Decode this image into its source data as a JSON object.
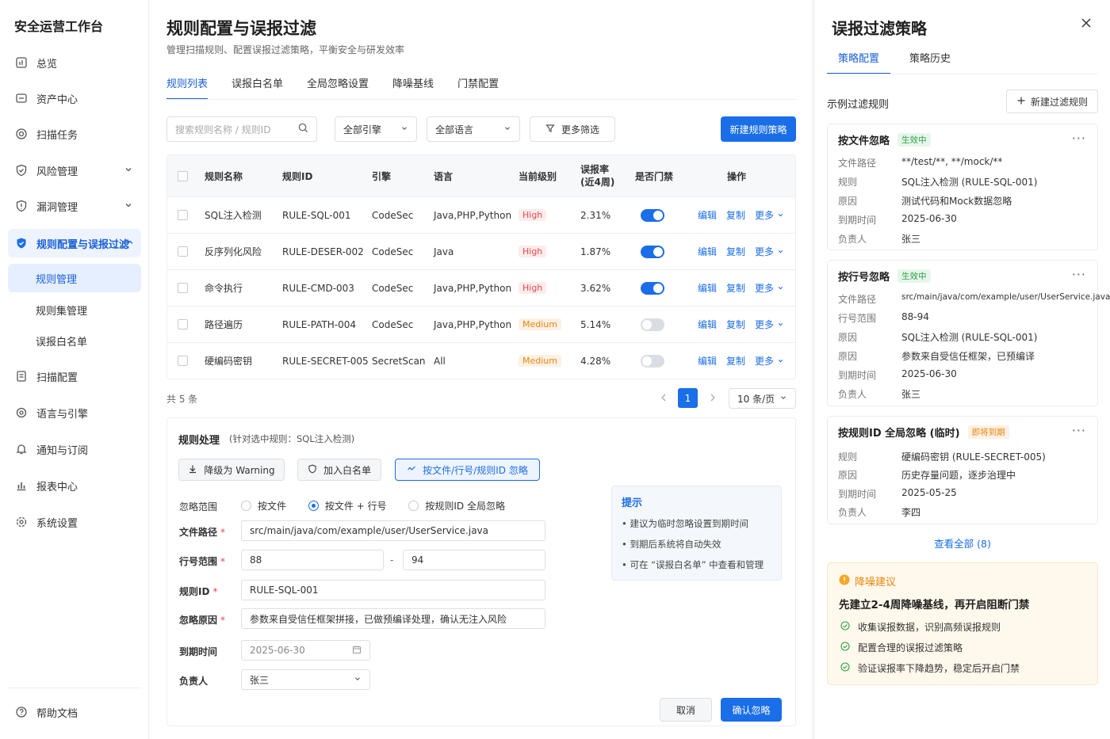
{
  "sidebar": {
    "app_title": "安全运营工作台",
    "items": [
      {
        "label": "总览",
        "icon": "dashboard-icon"
      },
      {
        "label": "资产中心",
        "icon": "asset-icon"
      },
      {
        "label": "扫描任务",
        "icon": "scan-icon"
      },
      {
        "label": "风险管理",
        "icon": "shield-icon"
      },
      {
        "label": "漏洞管理",
        "icon": "bug-icon"
      },
      {
        "label": "规则配置与误报过滤",
        "icon": "shield-filled-icon"
      },
      {
        "label": "扫描配置",
        "icon": "doc-icon"
      },
      {
        "label": "语言与引擎",
        "icon": "gear-icon"
      },
      {
        "label": "通知与订阅",
        "icon": "bell-icon"
      },
      {
        "label": "报表中心",
        "icon": "chart-icon"
      },
      {
        "label": "系统设置",
        "icon": "settings-icon"
      }
    ],
    "sub_items": [
      "规则管理",
      "规则集管理",
      "误报白名单"
    ],
    "help": "帮助文档"
  },
  "main": {
    "title": "规则配置与误报过滤",
    "subtitle": "管理扫描规则、配置误报过滤策略，平衡安全与研发效率",
    "tabs": [
      "规则列表",
      "误报白名单",
      "全局忽略设置",
      "降噪基线",
      "门禁配置"
    ],
    "search_placeholder": "搜索规则名称 / 规则ID",
    "engine_filter": "全部引擎",
    "lang_filter": "全部语言",
    "more_filter": "更多筛选",
    "new_button": "新建规则策略",
    "table": {
      "headers": [
        "规则名称",
        "规则ID",
        "引擎",
        "语言",
        "当前级别",
        "误报率",
        "(近4周)",
        "是否门禁",
        "操作"
      ],
      "rows": [
        {
          "name": "SQL注入检测",
          "id": "RULE-SQL-001",
          "engine": "CodeSec",
          "lang": "Java,PHP,Python",
          "level": "High",
          "rate": "2.31%",
          "gate": true
        },
        {
          "name": "反序列化风险",
          "id": "RULE-DESER-002",
          "engine": "CodeSec",
          "lang": "Java",
          "level": "High",
          "rate": "1.87%",
          "gate": true
        },
        {
          "name": "命令执行",
          "id": "RULE-CMD-003",
          "engine": "CodeSec",
          "lang": "Java,PHP,Python",
          "level": "High",
          "rate": "3.62%",
          "gate": true
        },
        {
          "name": "路径遍历",
          "id": "RULE-PATH-004",
          "engine": "CodeSec",
          "lang": "Java,PHP,Python",
          "level": "Medium",
          "rate": "5.14%",
          "gate": false
        },
        {
          "name": "硬编码密钥",
          "id": "RULE-SECRET-005",
          "engine": "SecretScan",
          "lang": "All",
          "level": "Medium",
          "rate": "4.28%",
          "gate": false
        }
      ],
      "actions": [
        "编辑",
        "复制",
        "更多"
      ]
    },
    "total": "共 5 条",
    "page": "1",
    "page_size": "10 条/页",
    "form": {
      "title": "规则处理",
      "title_note": "(针对选中规则：SQL注入检测)",
      "btn_downgrade": "降级为 Warning",
      "btn_whitelist": "加入白名单",
      "btn_ignore": "按文件/行号/规则ID 忽略",
      "scope_label": "忽略范围",
      "scope_options": [
        "按文件",
        "按文件 + 行号",
        "按规则ID 全局忽略"
      ],
      "file_label": "文件路径",
      "file_value": "src/main/java/com/example/user/UserService.java",
      "line_label": "行号范围",
      "line_from": "88",
      "line_sep": "-",
      "line_to": "94",
      "rule_label": "规则ID",
      "rule_value": "RULE-SQL-001",
      "reason_label": "忽略原因",
      "reason_value": "参数来自受信任框架拼接，已做预编译处理，确认无注入风险",
      "expire_label": "到期时间",
      "expire_value": "2025-06-30",
      "owner_label": "负责人",
      "owner_value": "张三",
      "tip_title": "提示",
      "tips": [
        "建议为临时忽略设置到期时间",
        "到期后系统将自动失效",
        "可在 “误报白名单” 中查看和管理"
      ],
      "cancel": "取消",
      "confirm": "确认忽略"
    }
  },
  "right": {
    "title": "误报过滤策略",
    "tabs": [
      "策略配置",
      "策略历史"
    ],
    "section_title": "示例过滤规则",
    "new_rule": "新建过滤规则",
    "cards": [
      {
        "title": "按文件忽略",
        "badge": "生效中",
        "rows": [
          [
            "文件路径",
            "**/test/**, **/mock/**"
          ],
          [
            "规则",
            "SQL注入检测 (RULE-SQL-001)"
          ],
          [
            "原因",
            "测试代码和Mock数据忽略"
          ],
          [
            "到期时间",
            "2025-06-30"
          ],
          [
            "负责人",
            "张三"
          ]
        ]
      },
      {
        "title": "按行号忽略",
        "badge": "生效中",
        "rows": [
          [
            "文件路径",
            "src/main/java/com/example/user/UserService.java"
          ],
          [
            "行号范围",
            "88-94"
          ],
          [
            "原因",
            "SQL注入检测 (RULE-SQL-001)"
          ],
          [
            "原因",
            "参数来自受信任框架，已预编译"
          ],
          [
            "到期时间",
            "2025-06-30"
          ],
          [
            "负责人",
            "张三"
          ]
        ]
      },
      {
        "title": "按规则ID 全局忽略 (临时)",
        "badge": "即将到期",
        "rows": [
          [
            "规则",
            "硬编码密钥 (RULE-SECRET-005)"
          ],
          [
            "原因",
            "历史存量问题，逐步治理中"
          ],
          [
            "到期时间",
            "2025-05-25"
          ],
          [
            "负责人",
            "李四"
          ]
        ]
      }
    ],
    "view_all": "查看全部 (8)",
    "advice": {
      "title": "降噪建议",
      "headline": "先建立2-4周降噪基线，再开启阻断门禁",
      "items": [
        "收集误报数据，识别高频误报规则",
        "配置合理的误报过滤策略",
        "验证误报率下降趋势，稳定后开启门禁"
      ]
    }
  },
  "colors": {
    "accent": "#1a6ee8",
    "high": "#e5484d",
    "medium": "#e8870e",
    "active_green": "#2aa245"
  }
}
